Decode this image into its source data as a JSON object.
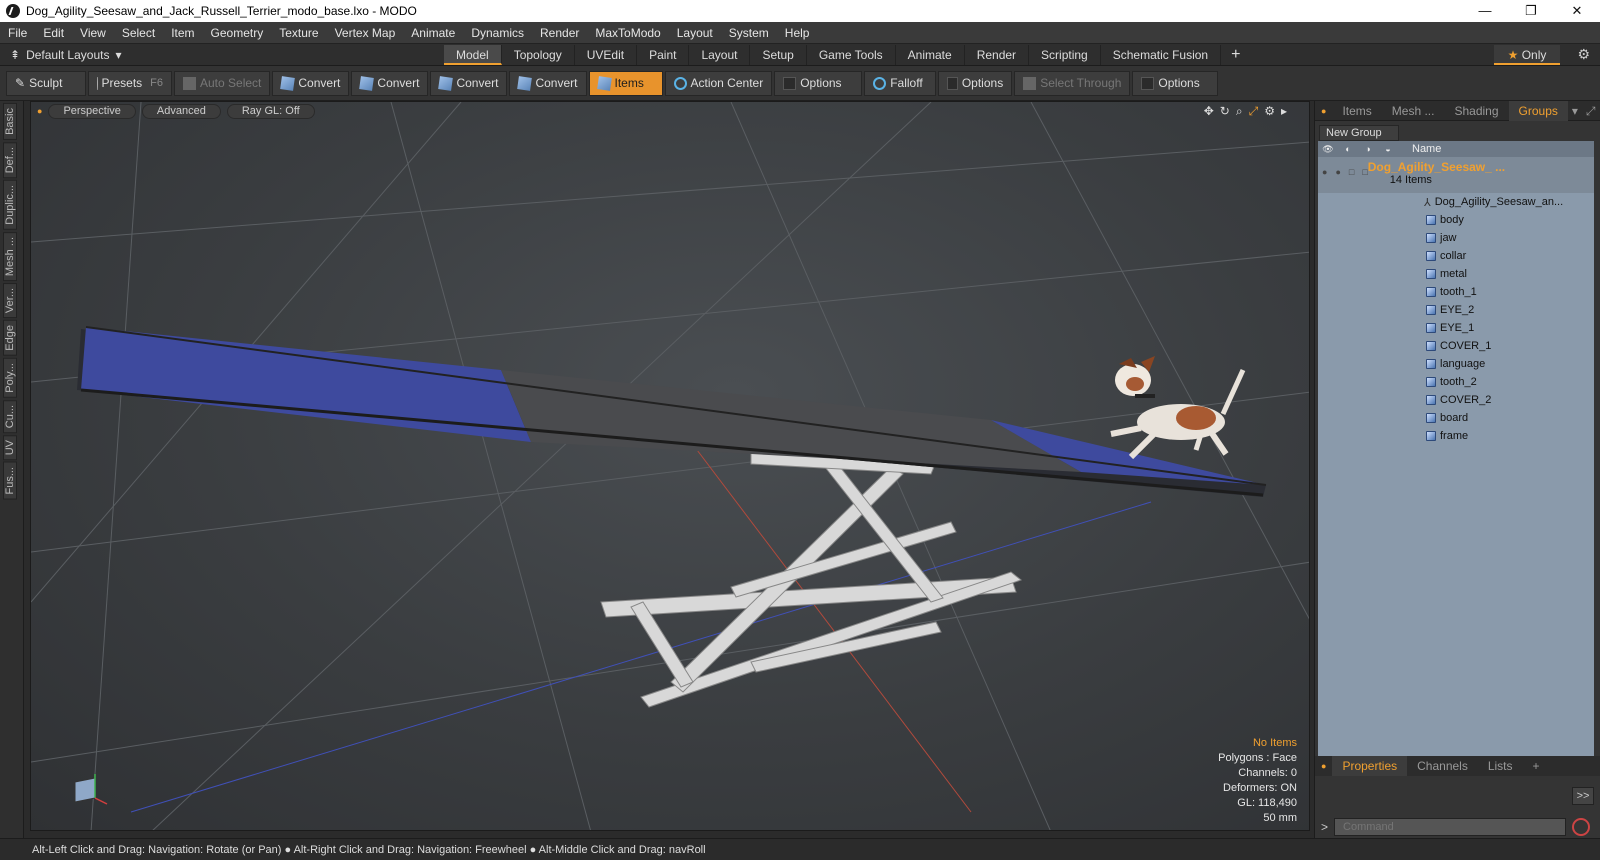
{
  "window": {
    "title": "Dog_Agility_Seesaw_and_Jack_Russell_Terrier_modo_base.lxo - MODO",
    "minimize": "—",
    "restore": "❐",
    "close": "✕"
  },
  "menu": [
    "File",
    "Edit",
    "View",
    "Select",
    "Item",
    "Geometry",
    "Texture",
    "Vertex Map",
    "Animate",
    "Dynamics",
    "Render",
    "MaxToModo",
    "Layout",
    "System",
    "Help"
  ],
  "layout_bar": {
    "layouts_label": "Default Layouts",
    "tabs": [
      "Model",
      "Topology",
      "UVEdit",
      "Paint",
      "Layout",
      "Setup",
      "Game Tools",
      "Animate",
      "Render",
      "Scripting",
      "Schematic Fusion"
    ],
    "active_tab": "Model",
    "only_label": "Only"
  },
  "toolbar": {
    "sculpt": "Sculpt",
    "presets": "Presets",
    "presets_key": "F6",
    "auto_select": "Auto Select",
    "convert": "Convert",
    "items": "Items",
    "action_center": "Action Center",
    "options": "Options",
    "falloff": "Falloff",
    "select_through": "Select Through"
  },
  "left_tabs": [
    "Basic",
    "Def...",
    "Duplic...",
    "Mesh ...",
    "Ver...",
    "Edge",
    "Poly...",
    "Cu...",
    "UV",
    "Fus..."
  ],
  "viewport": {
    "view_mode": "Perspective",
    "shading": "Advanced",
    "raygl": "Ray GL: Off",
    "info": {
      "no_items": "No Items",
      "polygons": "Polygons : Face",
      "channels": "Channels: 0",
      "deformers": "Deformers: ON",
      "gl": "GL: 118,490",
      "scale": "50 mm"
    }
  },
  "right_panel": {
    "tabs": [
      "Items",
      "Mesh ...",
      "Shading",
      "Groups"
    ],
    "active_tab": "Groups",
    "new_group": "New Group",
    "name_header": "Name",
    "group_name": "Dog_Agility_Seesaw_ ...",
    "group_count": "14 Items",
    "locator_item": "Dog_Agility_Seesaw_an...",
    "items": [
      "body",
      "jaw",
      "collar",
      "metal",
      "tooth_1",
      "EYE_2",
      "EYE_1",
      "COVER_1",
      "language",
      "tooth_2",
      "COVER_2",
      "board",
      "frame"
    ],
    "bottom_tabs": [
      "Properties",
      "Channels",
      "Lists"
    ],
    "bottom_active": "Properties",
    "command_placeholder": "Command",
    "expand": ">>"
  },
  "status": "Alt-Left Click and Drag: Navigation: Rotate (or Pan) ● Alt-Right Click and Drag: Navigation: Freewheel ● Alt-Middle Click and Drag: navRoll",
  "colors": {
    "accent": "#f0a030",
    "board_blue": "#3d4a9a",
    "board_gray": "#4a4a4a",
    "tree_bg": "#8a9aab"
  }
}
